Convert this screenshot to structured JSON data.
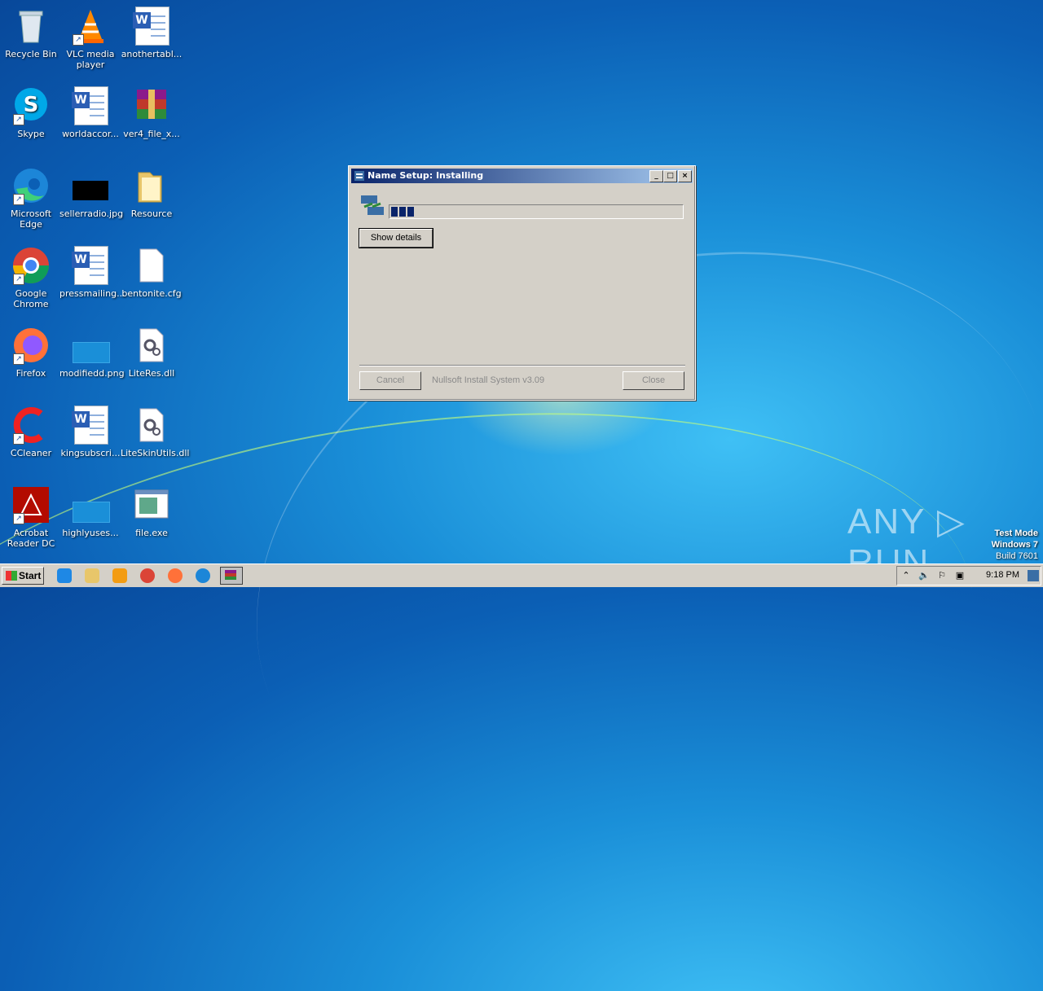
{
  "desktop": {
    "icons": [
      {
        "label": "Recycle Bin"
      },
      {
        "label": "VLC media player"
      },
      {
        "label": "anothertabl..."
      },
      {
        "label": "Skype"
      },
      {
        "label": "worldaccor..."
      },
      {
        "label": "ver4_file_x..."
      },
      {
        "label": "Microsoft Edge"
      },
      {
        "label": "sellerradio.jpg"
      },
      {
        "label": "Resource"
      },
      {
        "label": "Google Chrome"
      },
      {
        "label": "pressmailing..."
      },
      {
        "label": "bentonite.cfg"
      },
      {
        "label": "Firefox"
      },
      {
        "label": "modifiedd.png"
      },
      {
        "label": "LiteRes.dll"
      },
      {
        "label": "CCleaner"
      },
      {
        "label": "kingsubscri..."
      },
      {
        "label": "LiteSkinUtils.dll"
      },
      {
        "label": "Acrobat Reader DC"
      },
      {
        "label": "highlyuses..."
      },
      {
        "label": "file.exe"
      }
    ]
  },
  "dialog": {
    "title": "Name Setup: Installing",
    "progress_fraction": 0.09,
    "show_details_label": "Show details",
    "cancel_label": "Cancel",
    "branding": "Nullsoft Install System v3.09",
    "close_label": "Close",
    "minimize_glyph": "_",
    "maximize_glyph": "□",
    "close_glyph": "×"
  },
  "watermark": {
    "text": "ANY ▷ RUN"
  },
  "system": {
    "line1": "Test Mode",
    "line2": "Windows 7",
    "line3": "Build 7601"
  },
  "taskbar": {
    "start_label": "Start",
    "clock": "9:18 PM",
    "quick_launch": [
      "ie-icon",
      "explorer-icon",
      "media-player-icon",
      "chrome-icon",
      "firefox-icon",
      "edge-icon",
      "installer-task-icon"
    ],
    "tray_icons": [
      "show-hidden-icon",
      "volume-icon",
      "flag-icon",
      "network-icon"
    ]
  },
  "colors": {
    "titlebar_start": "#0a246a",
    "titlebar_end": "#a6caf0",
    "progress": "#0a246a",
    "face": "#d4d0c8"
  }
}
